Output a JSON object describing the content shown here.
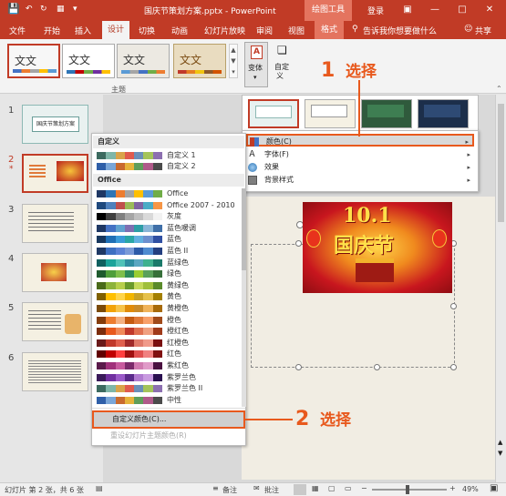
{
  "title_bar": {
    "doc_title": "国庆节策划方案.pptx - PowerPoint",
    "context_tab_group": "绘图工具",
    "login": "登录"
  },
  "tabs": [
    "文件",
    "开始",
    "插入",
    "设计",
    "切换",
    "动画",
    "幻灯片放映",
    "审阅",
    "视图",
    "格式"
  ],
  "active_tab": "设计",
  "tell_me": "告诉我你想要做什么",
  "share": "共享",
  "ribbon": {
    "theme_sample_text": "文文",
    "theme_group_label": "主题",
    "variant_button": "变体",
    "custom_button_line1": "自定",
    "custom_button_line2": "义"
  },
  "slide_numbers": [
    "1",
    "2",
    "3",
    "4",
    "5",
    "6"
  ],
  "slide1_title": "国庆节策划方案",
  "slide_banner": {
    "line1": "10.1",
    "line2": "国庆节"
  },
  "variant_menu": {
    "items": [
      {
        "label": "颜色(C)"
      },
      {
        "label": "字体(F)"
      },
      {
        "label": "效果"
      },
      {
        "label": "背景样式"
      }
    ]
  },
  "colors_menu": {
    "custom_header": "自定义",
    "office_header": "Office",
    "custom_items": [
      "自定义 1",
      "自定义 2"
    ],
    "office_items": [
      "Office",
      "Office 2007 - 2010",
      "灰度",
      "蓝色暖调",
      "蓝色",
      "蓝色 II",
      "蓝绿色",
      "绿色",
      "黄绿色",
      "黄色",
      "黄橙色",
      "橙色",
      "橙红色",
      "红橙色",
      "红色",
      "紫红色",
      "紫罗兰色",
      "紫罗兰色 II",
      "中性"
    ],
    "customize_colors": "自定义颜色(C)...",
    "reset_colors": "重设幻灯片主题颜色(R)"
  },
  "callouts": [
    {
      "number": "1",
      "text": "选择"
    },
    {
      "number": "2",
      "text": "选择"
    }
  ],
  "status_bar": {
    "slide_info": "幻灯片 第 2 张，共 6 张",
    "notes": "备注",
    "comments": "批注",
    "zoom": "49%"
  },
  "colors": {
    "accent": "#c13b26",
    "callout": "#e8591d",
    "highlight": "#d9d9d9"
  }
}
